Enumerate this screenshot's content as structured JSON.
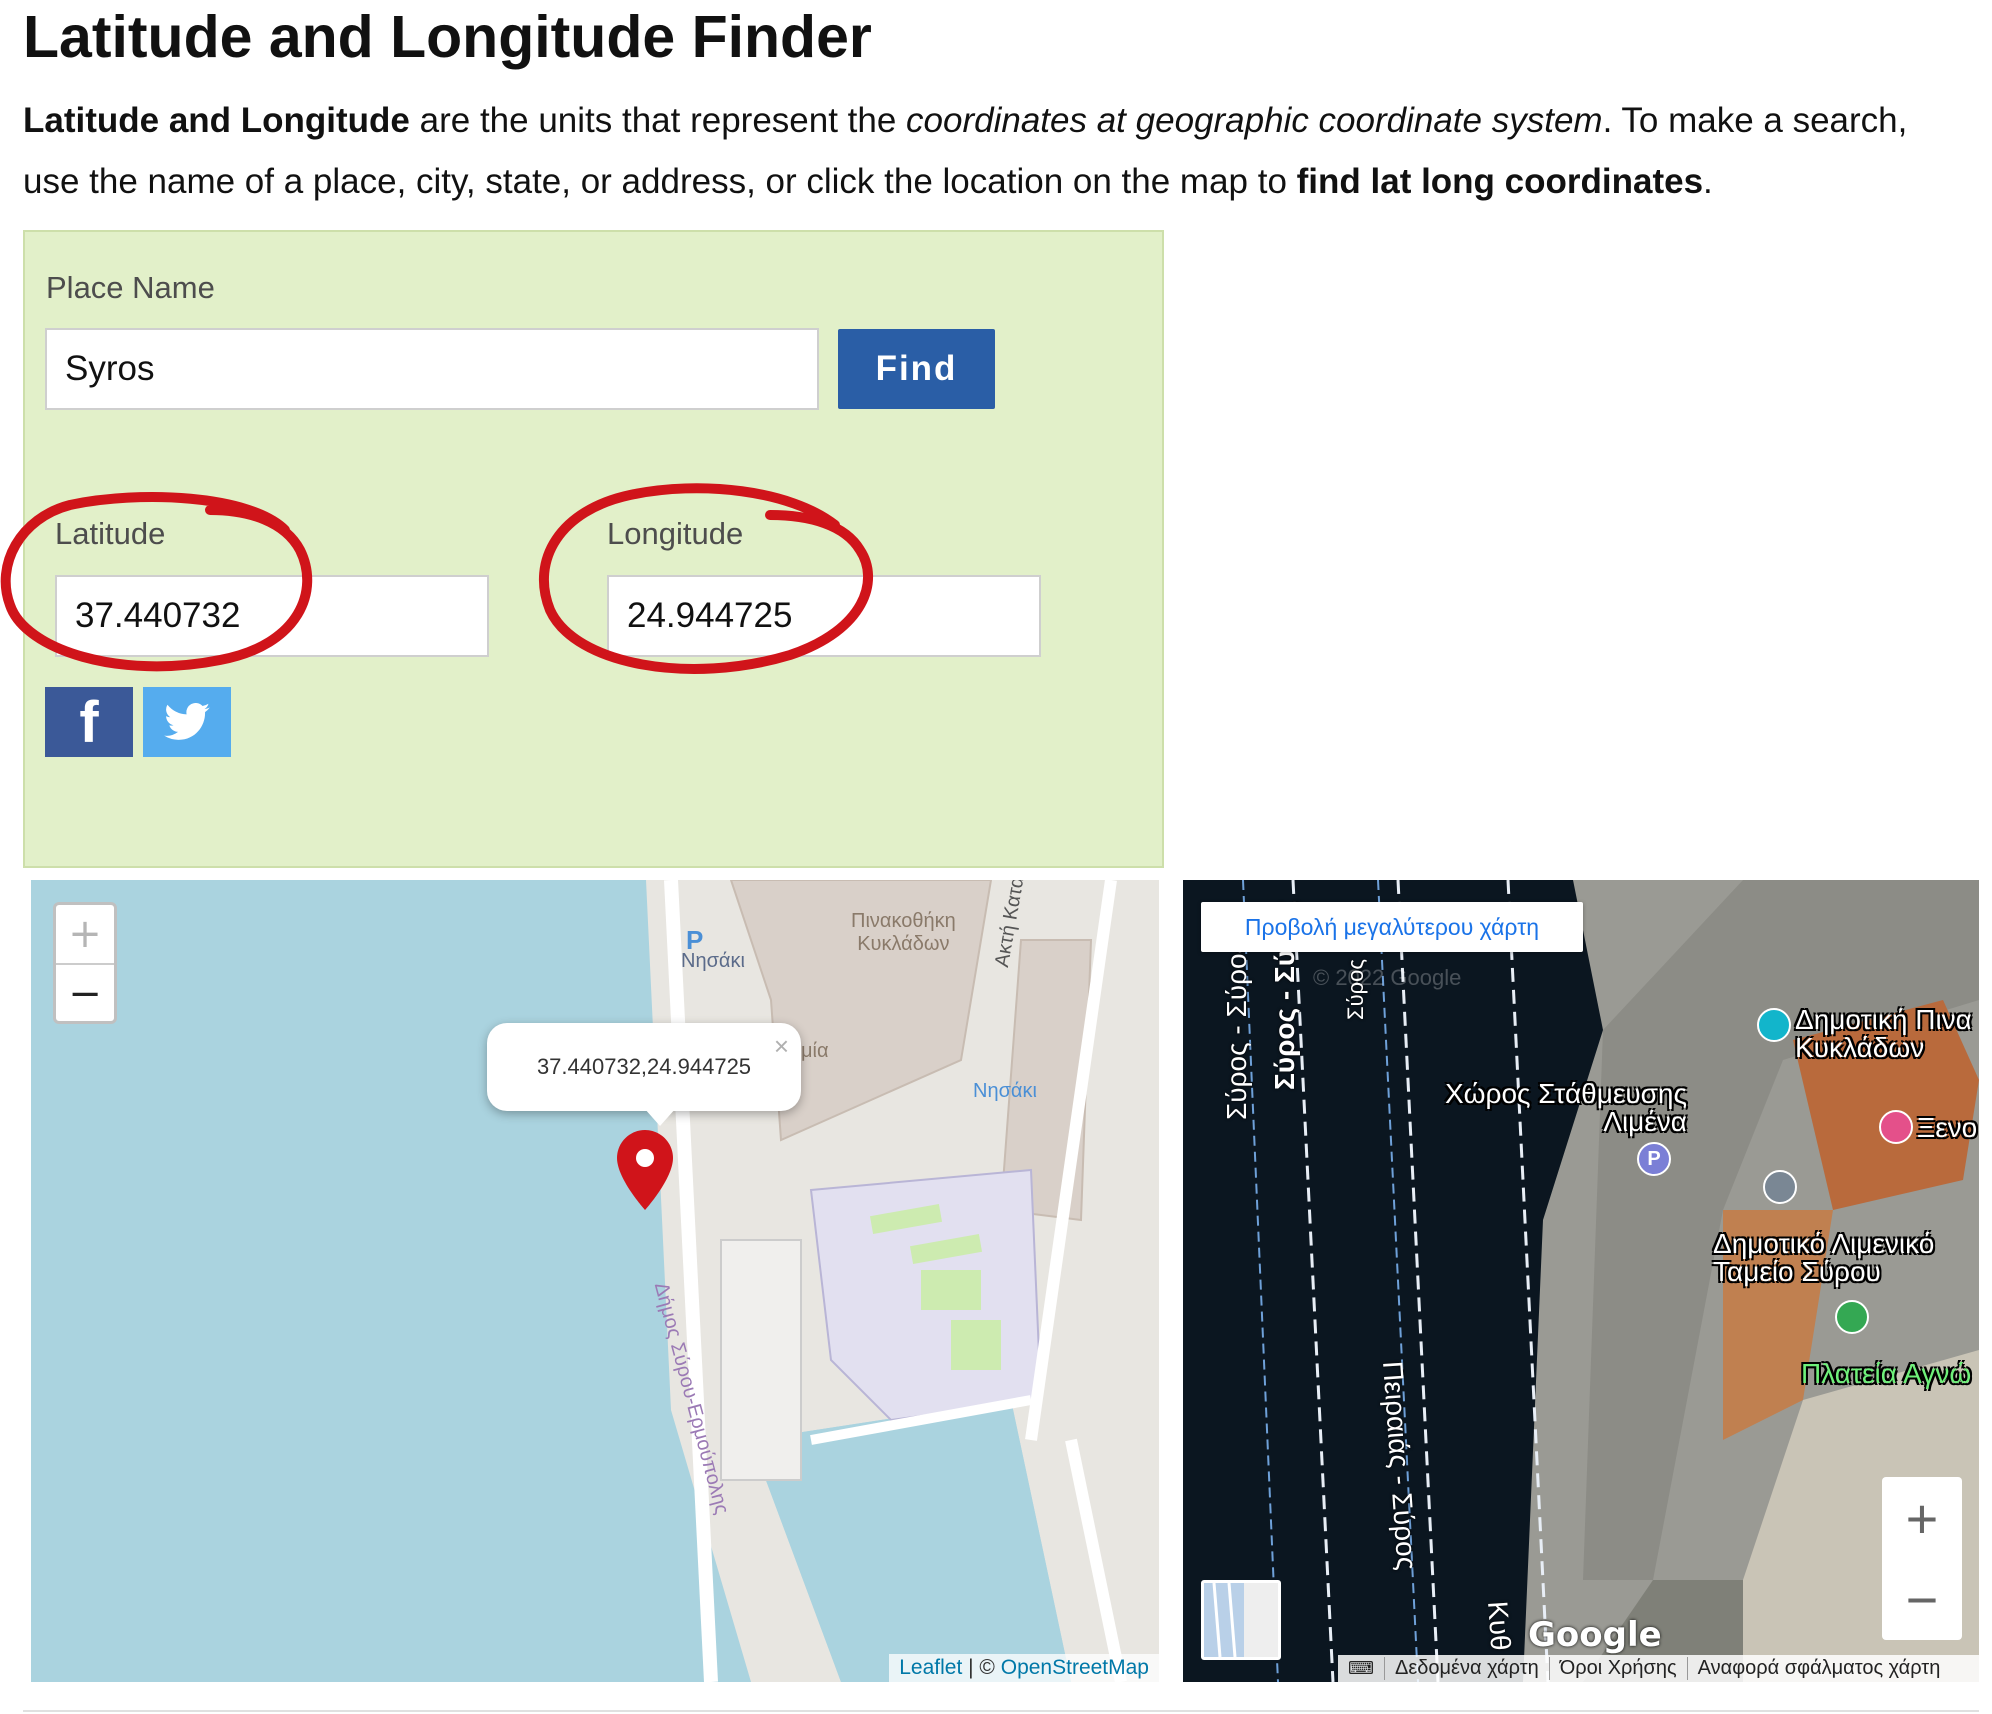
{
  "page": {
    "title": "Latitude and Longitude Finder",
    "intro": {
      "bold1": "Latitude and Longitude",
      "text1": " are the units that represent the ",
      "italic": "coordinates at geographic coordinate system",
      "text2": ". To make a search, use the name of a place, city, state, or address, or click the location on the map to ",
      "bold2": "find lat long coordinates",
      "text3": "."
    }
  },
  "finder": {
    "place_label": "Place Name",
    "place_value": "Syros",
    "find_label": "Find",
    "latitude_label": "Latitude",
    "latitude_value": "37.440732",
    "longitude_label": "Longitude",
    "longitude_value": "24.944725",
    "facebook_icon": "f",
    "annotation_color": "#d0141a"
  },
  "leaflet_map": {
    "zoom_in": "+",
    "zoom_out": "−",
    "popup_text": "37.440732,24.944725",
    "popup_close": "×",
    "attribution_leaflet": "Leaflet",
    "attribution_sep": " | © ",
    "attribution_osm": "OpenStreetMap",
    "labels": {
      "gallery": "Πινακοθήκη\nΚυκλάδων",
      "parking": "Νησάκι",
      "hotel": "Νησάκι",
      "road_vertical": "Ακτή Καταδρομικού Ε",
      "municipality": "Δήμος Σύρου-Ερμούπολης",
      "partial": "μία"
    }
  },
  "google_map": {
    "view_larger": "Προβολή μεγαλύτερου χάρτη",
    "poi_gallery": "Δημοτική Πινα\nΚυκλάδων",
    "poi_parking": "Χώρος Στάθμευσης\nΛιμένα",
    "poi_xen": "Ξενο",
    "poi_port_fund": "Δημοτικό Λιμενικό\nΤαμείο Σύρου",
    "poi_square": "Πλατεία Αγνώ",
    "road1": "Σύρος - Σύρος",
    "road2": "Σύρος - Σύρος",
    "road3": "Πειραιάς - Σύρος",
    "road4": "Σύρος",
    "road5": "Κυθ",
    "watermark": "© 2022 Google",
    "logo": "Google",
    "zoom_in": "+",
    "zoom_out": "−",
    "footer": [
      "Δεδομένα χάρτη",
      "Όροι Χρήσης",
      "Αναφορά σφάλματος χάρτη"
    ]
  },
  "colors": {
    "panel_bg": "#e2f0c9",
    "find_button": "#2a5ea6",
    "facebook": "#3b5998",
    "twitter": "#55acee",
    "water": "#aad3df",
    "marker": "#d0141a"
  }
}
